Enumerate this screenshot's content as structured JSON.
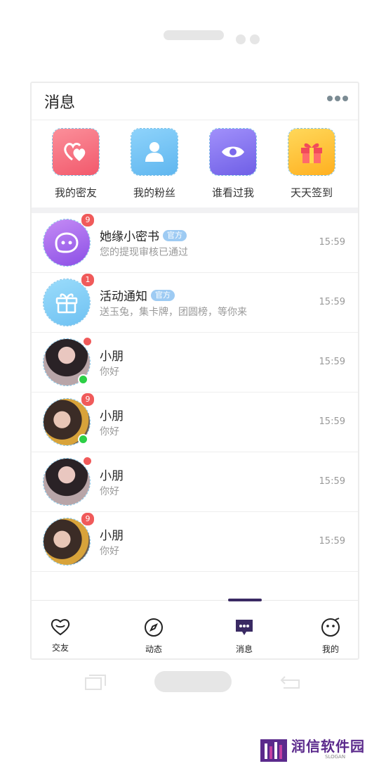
{
  "header": {
    "title": "消息",
    "more_icon": "more-icon"
  },
  "quick_actions": [
    {
      "label": "我的密友",
      "icon": "hearts-icon",
      "color": "#f76f80"
    },
    {
      "label": "我的粉丝",
      "icon": "person-icon",
      "color": "#7dc8f4"
    },
    {
      "label": "谁看过我",
      "icon": "eye-icon",
      "color": "#8a7af2"
    },
    {
      "label": "天天签到",
      "icon": "gift-box-icon",
      "color": "#ffc233"
    }
  ],
  "conversations": [
    {
      "name": "她缘小密书",
      "tag": "官方",
      "message": "您的提现审核已通过",
      "time": "15:59",
      "badge": "9"
    },
    {
      "name": "活动通知",
      "tag": "官方",
      "message": "送玉兔，集卡牌，团圆榜，等你来",
      "time": "15:59",
      "badge": "1"
    },
    {
      "name": "小朋",
      "message": "你好",
      "time": "15:59"
    },
    {
      "name": "小朋",
      "message": "你好",
      "time": "15:59",
      "badge": "9"
    },
    {
      "name": "小朋",
      "message": "你好",
      "time": "15:59"
    },
    {
      "name": "小朋",
      "message": "你好",
      "time": "15:59",
      "badge": "9"
    }
  ],
  "tabs": [
    {
      "label": "交友",
      "icon": "heart-chat-icon"
    },
    {
      "label": "动态",
      "icon": "compass-icon"
    },
    {
      "label": "消息",
      "icon": "message-icon",
      "active": true
    },
    {
      "label": "我的",
      "icon": "face-icon"
    }
  ],
  "logo": {
    "text": "润信软件园",
    "sub": "SLOGAN"
  },
  "colors": {
    "accent": "#3a2a63",
    "badge": "#f05a5a",
    "online": "#2bcf45"
  }
}
